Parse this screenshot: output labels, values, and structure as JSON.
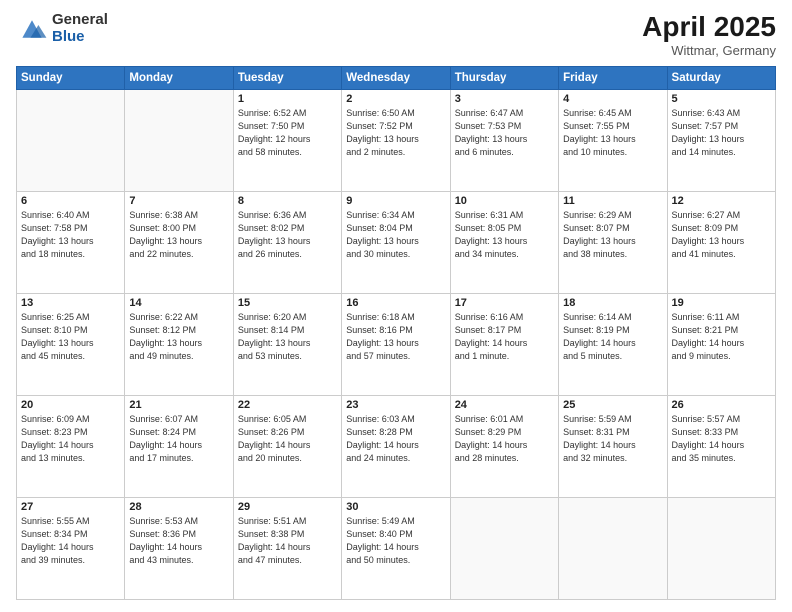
{
  "header": {
    "logo_general": "General",
    "logo_blue": "Blue",
    "month_title": "April 2025",
    "subtitle": "Wittmar, Germany"
  },
  "weekdays": [
    "Sunday",
    "Monday",
    "Tuesday",
    "Wednesday",
    "Thursday",
    "Friday",
    "Saturday"
  ],
  "weeks": [
    [
      {
        "day": "",
        "info": ""
      },
      {
        "day": "",
        "info": ""
      },
      {
        "day": "1",
        "info": "Sunrise: 6:52 AM\nSunset: 7:50 PM\nDaylight: 12 hours\nand 58 minutes."
      },
      {
        "day": "2",
        "info": "Sunrise: 6:50 AM\nSunset: 7:52 PM\nDaylight: 13 hours\nand 2 minutes."
      },
      {
        "day": "3",
        "info": "Sunrise: 6:47 AM\nSunset: 7:53 PM\nDaylight: 13 hours\nand 6 minutes."
      },
      {
        "day": "4",
        "info": "Sunrise: 6:45 AM\nSunset: 7:55 PM\nDaylight: 13 hours\nand 10 minutes."
      },
      {
        "day": "5",
        "info": "Sunrise: 6:43 AM\nSunset: 7:57 PM\nDaylight: 13 hours\nand 14 minutes."
      }
    ],
    [
      {
        "day": "6",
        "info": "Sunrise: 6:40 AM\nSunset: 7:58 PM\nDaylight: 13 hours\nand 18 minutes."
      },
      {
        "day": "7",
        "info": "Sunrise: 6:38 AM\nSunset: 8:00 PM\nDaylight: 13 hours\nand 22 minutes."
      },
      {
        "day": "8",
        "info": "Sunrise: 6:36 AM\nSunset: 8:02 PM\nDaylight: 13 hours\nand 26 minutes."
      },
      {
        "day": "9",
        "info": "Sunrise: 6:34 AM\nSunset: 8:04 PM\nDaylight: 13 hours\nand 30 minutes."
      },
      {
        "day": "10",
        "info": "Sunrise: 6:31 AM\nSunset: 8:05 PM\nDaylight: 13 hours\nand 34 minutes."
      },
      {
        "day": "11",
        "info": "Sunrise: 6:29 AM\nSunset: 8:07 PM\nDaylight: 13 hours\nand 38 minutes."
      },
      {
        "day": "12",
        "info": "Sunrise: 6:27 AM\nSunset: 8:09 PM\nDaylight: 13 hours\nand 41 minutes."
      }
    ],
    [
      {
        "day": "13",
        "info": "Sunrise: 6:25 AM\nSunset: 8:10 PM\nDaylight: 13 hours\nand 45 minutes."
      },
      {
        "day": "14",
        "info": "Sunrise: 6:22 AM\nSunset: 8:12 PM\nDaylight: 13 hours\nand 49 minutes."
      },
      {
        "day": "15",
        "info": "Sunrise: 6:20 AM\nSunset: 8:14 PM\nDaylight: 13 hours\nand 53 minutes."
      },
      {
        "day": "16",
        "info": "Sunrise: 6:18 AM\nSunset: 8:16 PM\nDaylight: 13 hours\nand 57 minutes."
      },
      {
        "day": "17",
        "info": "Sunrise: 6:16 AM\nSunset: 8:17 PM\nDaylight: 14 hours\nand 1 minute."
      },
      {
        "day": "18",
        "info": "Sunrise: 6:14 AM\nSunset: 8:19 PM\nDaylight: 14 hours\nand 5 minutes."
      },
      {
        "day": "19",
        "info": "Sunrise: 6:11 AM\nSunset: 8:21 PM\nDaylight: 14 hours\nand 9 minutes."
      }
    ],
    [
      {
        "day": "20",
        "info": "Sunrise: 6:09 AM\nSunset: 8:23 PM\nDaylight: 14 hours\nand 13 minutes."
      },
      {
        "day": "21",
        "info": "Sunrise: 6:07 AM\nSunset: 8:24 PM\nDaylight: 14 hours\nand 17 minutes."
      },
      {
        "day": "22",
        "info": "Sunrise: 6:05 AM\nSunset: 8:26 PM\nDaylight: 14 hours\nand 20 minutes."
      },
      {
        "day": "23",
        "info": "Sunrise: 6:03 AM\nSunset: 8:28 PM\nDaylight: 14 hours\nand 24 minutes."
      },
      {
        "day": "24",
        "info": "Sunrise: 6:01 AM\nSunset: 8:29 PM\nDaylight: 14 hours\nand 28 minutes."
      },
      {
        "day": "25",
        "info": "Sunrise: 5:59 AM\nSunset: 8:31 PM\nDaylight: 14 hours\nand 32 minutes."
      },
      {
        "day": "26",
        "info": "Sunrise: 5:57 AM\nSunset: 8:33 PM\nDaylight: 14 hours\nand 35 minutes."
      }
    ],
    [
      {
        "day": "27",
        "info": "Sunrise: 5:55 AM\nSunset: 8:34 PM\nDaylight: 14 hours\nand 39 minutes."
      },
      {
        "day": "28",
        "info": "Sunrise: 5:53 AM\nSunset: 8:36 PM\nDaylight: 14 hours\nand 43 minutes."
      },
      {
        "day": "29",
        "info": "Sunrise: 5:51 AM\nSunset: 8:38 PM\nDaylight: 14 hours\nand 47 minutes."
      },
      {
        "day": "30",
        "info": "Sunrise: 5:49 AM\nSunset: 8:40 PM\nDaylight: 14 hours\nand 50 minutes."
      },
      {
        "day": "",
        "info": ""
      },
      {
        "day": "",
        "info": ""
      },
      {
        "day": "",
        "info": ""
      }
    ]
  ]
}
